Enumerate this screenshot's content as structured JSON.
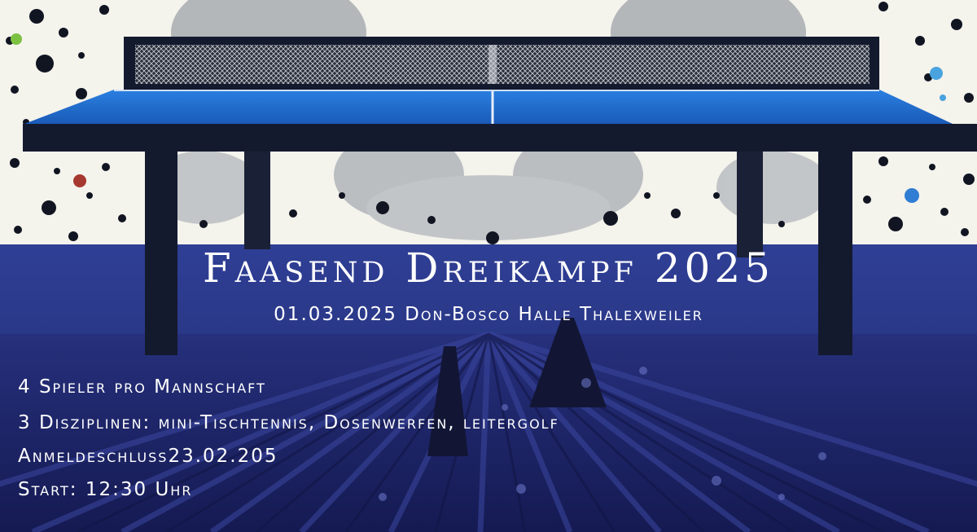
{
  "poster": {
    "title": "Faasend Dreikampf 2025",
    "subtitle": "01.03.2025 Don-Bosco Halle Thalexweiler",
    "details": [
      "4 Spieler pro Mannschaft",
      "3 Disziplinen: mini-Tischtennis, Dosenwerfen, leitergolf",
      "Anmeldeschluss23.02.205",
      "Start: 12:30 Uhr"
    ]
  },
  "colors": {
    "background": "#f4f3ec",
    "band": "#2c3a8e",
    "floor": "#1c2466",
    "table_top": "#1f6fd0",
    "table_frame": "#141a2e",
    "text": "#ffffff"
  },
  "illustration": {
    "subject": "ping-pong-table",
    "icon": "table-tennis-icon"
  }
}
